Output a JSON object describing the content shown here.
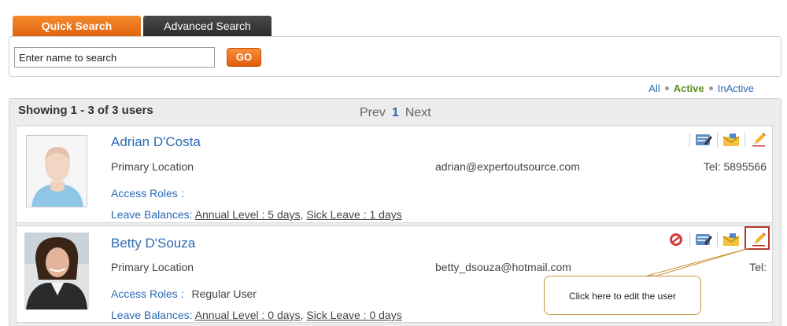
{
  "tabs": {
    "quick": "Quick Search",
    "advanced": "Advanced Search"
  },
  "search": {
    "placeholder": "Enter name to search",
    "go_label": "GO"
  },
  "filters": {
    "all": "All",
    "active": "Active",
    "inactive": "InActive"
  },
  "results": {
    "showing": "Showing 1 - 3 of 3 users",
    "pager": {
      "prev": "Prev",
      "current": "1",
      "next": "Next"
    }
  },
  "users": [
    {
      "name": "Adrian D'Costa",
      "location": "Primary Location",
      "email": "adrian@expertoutsource.com",
      "tel": "Tel: 5895566",
      "access_roles_label": "Access Roles :",
      "access_roles_value": "",
      "leave_label": "Leave Balances:",
      "annual": "Annual Level : 5 days",
      "sick": "Sick Leave : 1 days"
    },
    {
      "name": "Betty D'Souza",
      "location": "Primary Location",
      "email": "betty_dsouza@hotmail.com",
      "tel": "Tel:",
      "access_roles_label": "Access Roles :",
      "access_roles_value": "Regular User",
      "leave_label": "Leave Balances:",
      "annual": "Annual Level : 0 days",
      "sick": "Sick Leave : 0 days"
    }
  ],
  "callout": {
    "text": "Click here to edit the user"
  },
  "icons": [
    "view-card-icon",
    "email-icon",
    "edit-pencil-icon",
    "deactivate-icon"
  ],
  "colors": {
    "accent_orange": "#e06410",
    "link_blue": "#2a6ab3",
    "active_green": "#5a8f1a",
    "callout_border": "#c8943c"
  }
}
